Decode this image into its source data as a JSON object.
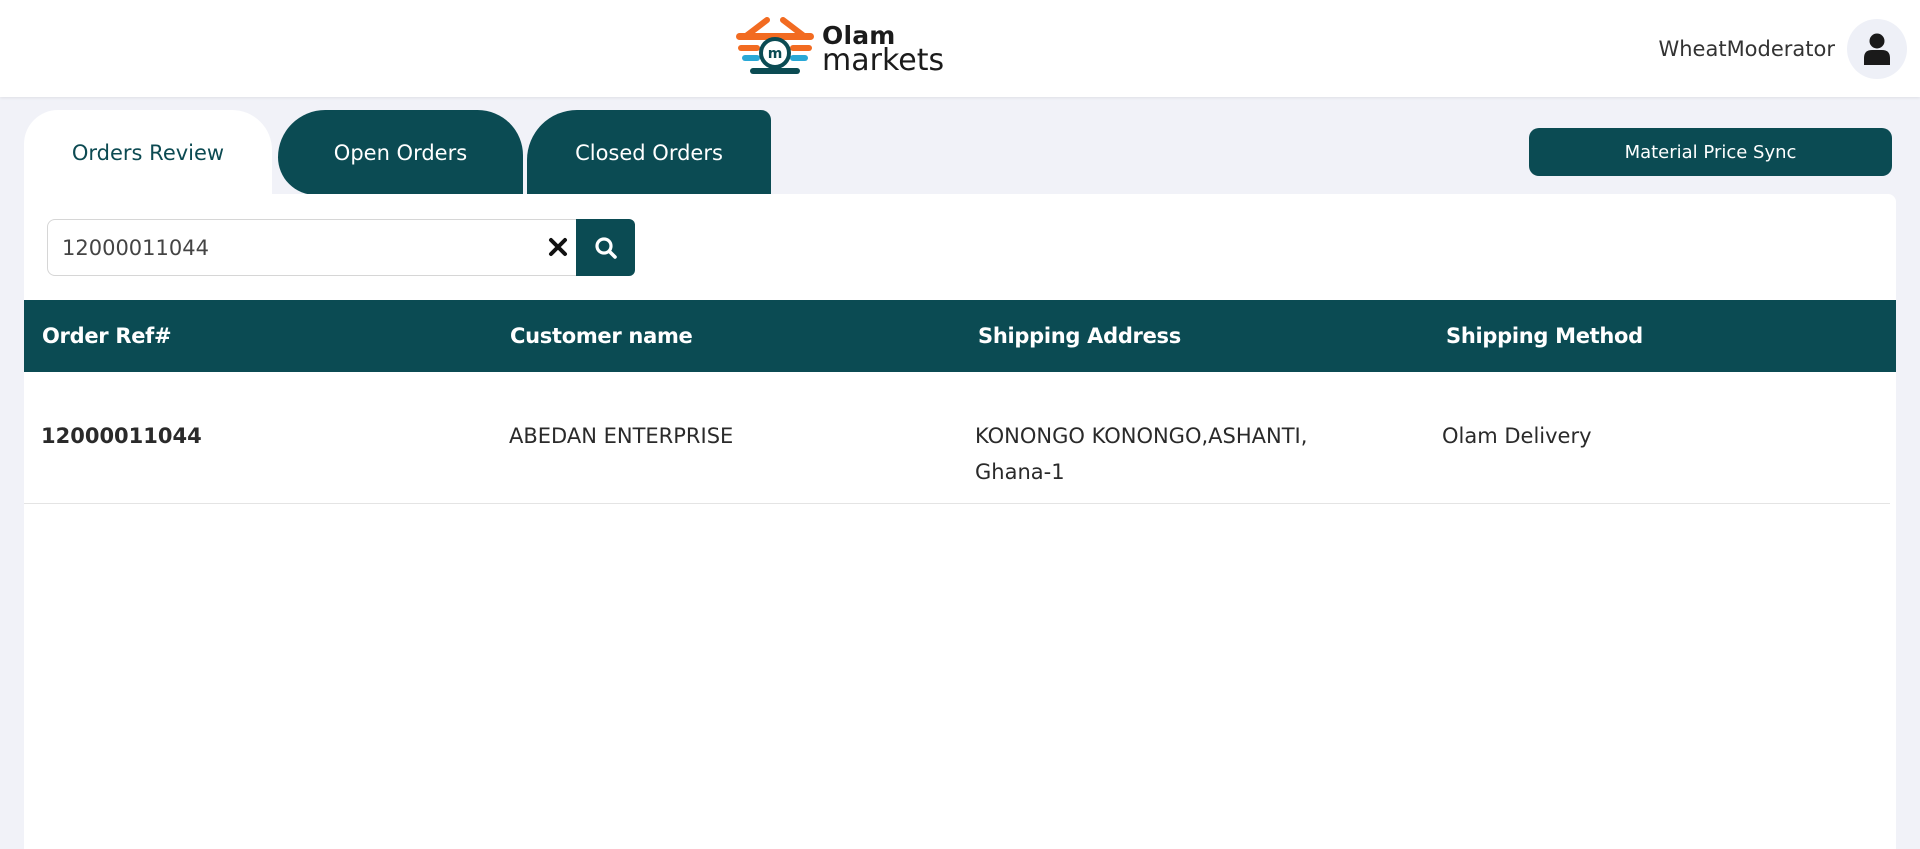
{
  "header": {
    "brand_line1": "Olam",
    "brand_line2": "markets",
    "username": "WheatModerator"
  },
  "tabs": [
    {
      "label": "Orders Review",
      "active": true
    },
    {
      "label": "Open Orders",
      "active": false
    },
    {
      "label": "Closed Orders",
      "active": false
    }
  ],
  "sync_button": "Material Price Sync",
  "search": {
    "value": "12000011044",
    "placeholder": ""
  },
  "table": {
    "columns": [
      "Order Ref#",
      "Customer name",
      "Shipping Address",
      "Shipping Method"
    ],
    "rows": [
      {
        "order_ref": "12000011044",
        "customer_name": "ABEDAN ENTERPRISE",
        "shipping_address_line1": "KONONGO KONONGO,ASHANTI,",
        "shipping_address_line2": "Ghana-1",
        "shipping_method": "Olam Delivery"
      }
    ]
  },
  "colors": {
    "primary": "#0b4b53",
    "background": "#f1f2f8",
    "logo_orange": "#f26b21",
    "logo_blue": "#29a8d6"
  },
  "icons": [
    "basket-logo-icon",
    "user-icon",
    "close-icon",
    "search-icon"
  ]
}
